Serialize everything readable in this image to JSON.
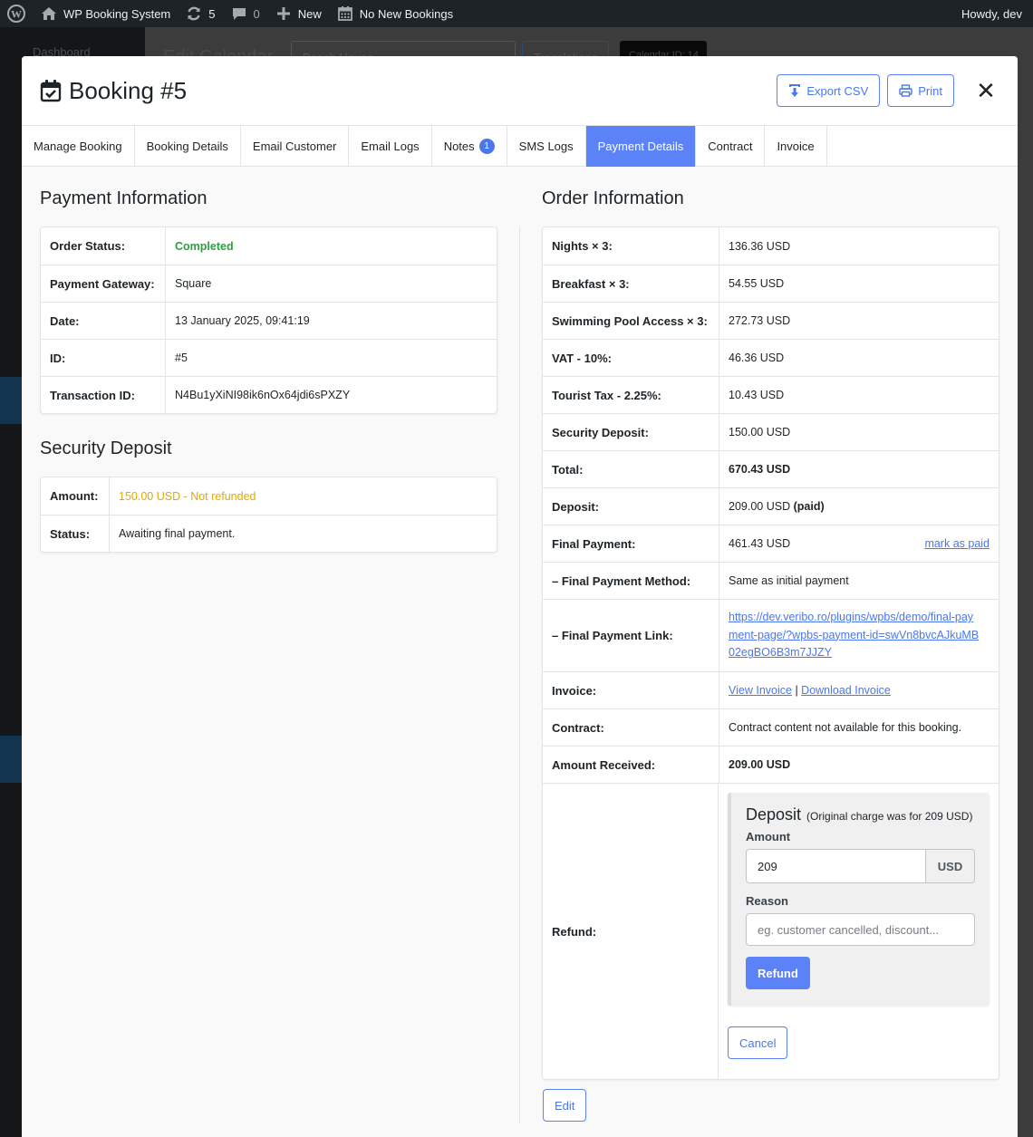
{
  "admin_bar": {
    "site_name": "WP Booking System",
    "updates_count": "5",
    "comments_count": "0",
    "new_label": "New",
    "bookings_label": "No New Bookings",
    "howdy": "Howdy, dev"
  },
  "background": {
    "sidebar_first_item": "Dashboard",
    "page_title": "Edit Calendar",
    "calendar_name": "Beach House",
    "translations_button": "Translations",
    "calendar_id_badge": "Calendar ID: 14"
  },
  "modal": {
    "title": "Booking #5",
    "export_csv_label": "Export CSV",
    "print_label": "Print"
  },
  "tabs": [
    {
      "label": "Manage Booking"
    },
    {
      "label": "Booking Details"
    },
    {
      "label": "Email Customer"
    },
    {
      "label": "Email Logs"
    },
    {
      "label": "Notes",
      "badge": "1"
    },
    {
      "label": "SMS Logs"
    },
    {
      "label": "Payment Details",
      "active": true
    },
    {
      "label": "Contract"
    },
    {
      "label": "Invoice"
    }
  ],
  "payment_info": {
    "title": "Payment Information",
    "rows": [
      {
        "label": "Order Status:",
        "value": "Completed"
      },
      {
        "label": "Payment Gateway:",
        "value": "Square"
      },
      {
        "label": "Date:",
        "value": "13 January 2025, 09:41:19"
      },
      {
        "label": "ID:",
        "value": "#5"
      },
      {
        "label": "Transaction ID:",
        "value": "N4Bu1yXiNI98ik6nOx64jdi6sPXZY"
      }
    ]
  },
  "security_deposit": {
    "title": "Security Deposit",
    "amount_label": "Amount:",
    "amount_value": "150.00 USD - Not refunded",
    "status_label": "Status:",
    "status_value": "Awaiting final payment."
  },
  "order_info": {
    "title": "Order Information",
    "rows": [
      {
        "label": "Nights × 3:",
        "value": "136.36 USD"
      },
      {
        "label": "Breakfast × 3:",
        "value": "54.55 USD"
      },
      {
        "label": "Swimming Pool Access × 3:",
        "value": "272.73 USD"
      },
      {
        "label": "VAT - 10%:",
        "value": "46.36 USD"
      },
      {
        "label": "Tourist Tax - 2.25%:",
        "value": "10.43 USD"
      },
      {
        "label": "Security Deposit:",
        "value": "150.00 USD"
      },
      {
        "label": "Total:",
        "value": "670.43 USD"
      },
      {
        "label": "Deposit:",
        "value": "209.00 USD",
        "suffix": "(paid)"
      },
      {
        "label": "Final Payment:",
        "value": "461.43 USD",
        "action": "mark as paid"
      },
      {
        "label": "– Final Payment Method:",
        "value": "Same as initial payment"
      },
      {
        "label": "– Final Payment Link:",
        "value": "https://dev.veribo.ro/plugins/wpbs/demo/final-payment-page/?wpbs-payment-id=swVn8bvcAJkuMB02egBO6B3m7JJZY"
      },
      {
        "label": "Invoice:",
        "view_invoice": "View Invoice",
        "separator": "|",
        "download_invoice": "Download Invoice"
      },
      {
        "label": "Contract:",
        "value": "Contract content not available for this booking."
      },
      {
        "label": "Amount Received:",
        "value": "209.00 USD"
      },
      {
        "label": "Refund:"
      }
    ]
  },
  "refund": {
    "heading": "Deposit",
    "note": "(Original charge was for 209 USD)",
    "amount_label": "Amount",
    "amount_value": "209",
    "currency": "USD",
    "reason_label": "Reason",
    "reason_placeholder": "eg. customer cancelled, discount...",
    "refund_button": "Refund",
    "cancel_button": "Cancel"
  },
  "edit_button": "Edit"
}
